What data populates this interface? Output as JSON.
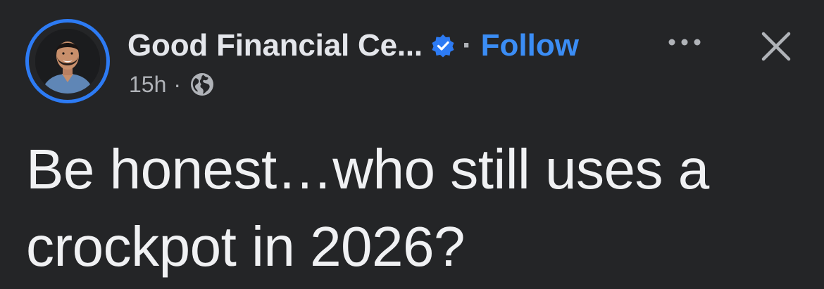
{
  "post": {
    "author": {
      "name": "Good Financial Ce...",
      "verified": true,
      "separator": "·",
      "follow_label": "Follow"
    },
    "meta": {
      "timestamp": "15h",
      "separator": "·",
      "audience_icon": "globe-icon"
    },
    "actions": {
      "more_icon": "more-horizontal-icon",
      "close_icon": "close-icon"
    },
    "text": "Be honest…who still uses a crockpot in 2026?"
  },
  "colors": {
    "background": "#242527",
    "accent": "#2d7bf4",
    "follow": "#3b8df5",
    "secondary_text": "#b0b3b8",
    "primary_text": "#e4e6eb"
  }
}
